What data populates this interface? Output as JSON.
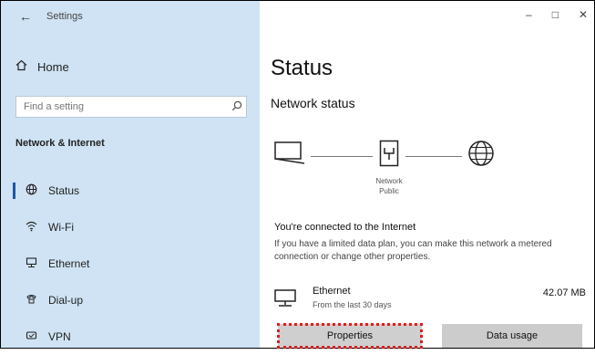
{
  "window": {
    "title": "Settings",
    "controls": {
      "minimize": "–",
      "maximize": "□",
      "close": "✕"
    }
  },
  "sidebar": {
    "back_glyph": "←",
    "home": {
      "icon": "home-icon",
      "label": "Home"
    },
    "search": {
      "placeholder": "Find a setting"
    },
    "section_title": "Network & Internet",
    "items": [
      {
        "icon": "globe-icon",
        "label": "Status"
      },
      {
        "icon": "wifi-icon",
        "label": "Wi-Fi"
      },
      {
        "icon": "ethernet-icon",
        "label": "Ethernet"
      },
      {
        "icon": "dial-up-icon",
        "label": "Dial-up"
      },
      {
        "icon": "vpn-icon",
        "label": "VPN"
      }
    ]
  },
  "main": {
    "title": "Status",
    "subheading": "Network status",
    "network_name": "Network",
    "network_type": "Public",
    "status_heading": "You're connected to the Internet",
    "status_description": "If you have a limited data plan, you can make this network a metered connection or change other properties.",
    "connection": {
      "icon": "ethernet-icon",
      "name": "Ethernet",
      "detail": "From the last 30 days",
      "usage": "42.07 MB"
    },
    "buttons": {
      "properties": "Properties",
      "data_usage": "Data usage"
    }
  },
  "colors": {
    "sidebar_bg": "#cfe3f4",
    "accent": "#1f57a4",
    "highlight": "#e31b1b",
    "button_bg": "#cccccc"
  }
}
